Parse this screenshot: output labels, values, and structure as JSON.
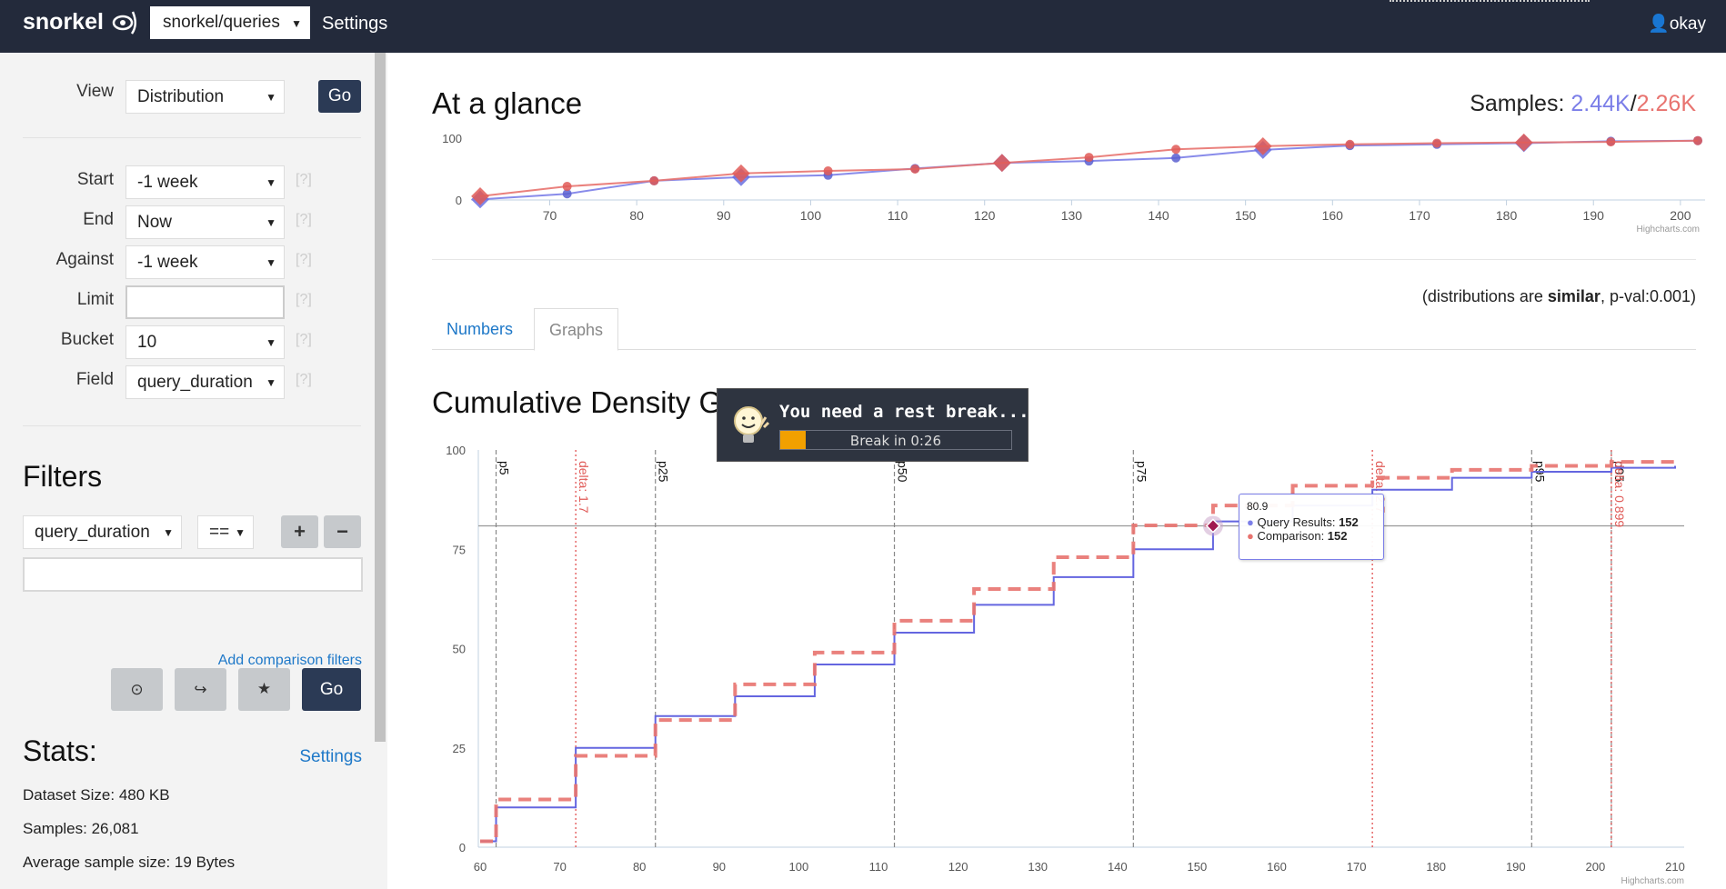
{
  "nav": {
    "logo": "snorkel",
    "dataset": "snorkel/queries",
    "settings": "Settings",
    "user": "okay"
  },
  "controls": {
    "view_label": "View",
    "view_value": "Distribution",
    "go": "Go",
    "start_label": "Start",
    "start_value": "-1 week",
    "end_label": "End",
    "end_value": "Now",
    "against_label": "Against",
    "against_value": "-1 week",
    "limit_label": "Limit",
    "limit_value": "",
    "bucket_label": "Bucket",
    "bucket_value": "10",
    "field_label": "Field",
    "field_value": "query_duration",
    "help": "[?]"
  },
  "filters": {
    "title": "Filters",
    "field": "query_duration",
    "op": "==",
    "plus": "+",
    "minus": "−",
    "value": "",
    "add_comparison": "Add comparison filters",
    "go": "Go"
  },
  "stats": {
    "title": "Stats:",
    "settings": "Settings",
    "dataset_size": "Dataset Size: 480 KB",
    "samples": "Samples: 26,081",
    "avg_size": "Average sample size: 19 Bytes"
  },
  "glance": {
    "title": "At a glance",
    "samples_label": "Samples: ",
    "samples_a": "2.44K",
    "sep": "/",
    "samples_b": "2.26K",
    "color_a": "#7b7ee8",
    "color_b": "#e8736f",
    "credit": "Highcharts.com"
  },
  "similarity": {
    "prefix": "(distributions are ",
    "word": "similar",
    "suffix": ", p-val:0.001)"
  },
  "tabs": [
    {
      "label": "Numbers"
    },
    {
      "label": "Graphs"
    }
  ],
  "cdf": {
    "title": "Cumulative Density G",
    "credit": "Highcharts.com"
  },
  "tooltip": {
    "x": "80.9",
    "s1_label": "Query Results: ",
    "s1_value": "152",
    "s2_label": "Comparison: ",
    "s2_value": "152"
  },
  "popup": {
    "title": "You need a rest break...",
    "progress_label": "Break in 0:26",
    "progress": 0.11
  },
  "chart_data": [
    {
      "type": "line",
      "title": "At a glance",
      "xlim": [
        62,
        202
      ],
      "ylim": [
        0,
        100
      ],
      "x_ticks": [
        70,
        80,
        90,
        100,
        110,
        120,
        130,
        140,
        150,
        160,
        170,
        180,
        190,
        200
      ],
      "y_ticks": [
        0,
        100
      ],
      "series": [
        {
          "name": "Query Results",
          "color": "#7b7ee8",
          "points": [
            [
              62,
              1
            ],
            [
              72,
              10
            ],
            [
              82,
              31
            ],
            [
              92,
              37
            ],
            [
              102,
              40
            ],
            [
              112,
              51
            ],
            [
              122,
              60
            ],
            [
              132,
              63
            ],
            [
              142,
              68
            ],
            [
              152,
              81
            ],
            [
              162,
              88
            ],
            [
              172,
              90
            ],
            [
              182,
              92
            ],
            [
              192,
              95
            ],
            [
              202,
              96
            ]
          ]
        },
        {
          "name": "Comparison",
          "color": "#e8736f",
          "points": [
            [
              62,
              6
            ],
            [
              72,
              22
            ],
            [
              82,
              31
            ],
            [
              92,
              43
            ],
            [
              102,
              47
            ],
            [
              112,
              50
            ],
            [
              122,
              60
            ],
            [
              132,
              69
            ],
            [
              142,
              82
            ],
            [
              152,
              87
            ],
            [
              162,
              90
            ],
            [
              172,
              92
            ],
            [
              182,
              93
            ],
            [
              192,
              94
            ],
            [
              202,
              96
            ]
          ]
        }
      ]
    },
    {
      "type": "line",
      "title": "Cumulative Density G",
      "xlim": [
        60,
        210
      ],
      "ylim": [
        0,
        100
      ],
      "x_ticks": [
        60,
        70,
        80,
        90,
        100,
        110,
        120,
        130,
        140,
        150,
        160,
        170,
        180,
        190,
        200,
        210
      ],
      "y_ticks": [
        0,
        25,
        50,
        75,
        100
      ],
      "series": [
        {
          "name": "Query Results",
          "color": "#6466e0",
          "steps": [
            [
              60,
              1.5
            ],
            [
              62,
              10
            ],
            [
              72,
              25
            ],
            [
              82,
              33
            ],
            [
              92,
              38
            ],
            [
              102,
              46
            ],
            [
              112,
              54
            ],
            [
              122,
              61
            ],
            [
              132,
              68
            ],
            [
              142,
              75
            ],
            [
              152,
              82
            ],
            [
              162,
              86
            ],
            [
              172,
              90
            ],
            [
              182,
              93
            ],
            [
              192,
              94.5
            ],
            [
              202,
              95.5
            ],
            [
              210,
              96
            ]
          ]
        },
        {
          "name": "Comparison",
          "color": "#e8736f",
          "steps": [
            [
              60,
              1.5
            ],
            [
              62,
              12
            ],
            [
              72,
              23
            ],
            [
              82,
              32
            ],
            [
              92,
              41
            ],
            [
              102,
              49
            ],
            [
              112,
              57
            ],
            [
              122,
              65
            ],
            [
              132,
              73
            ],
            [
              142,
              81
            ],
            [
              152,
              86
            ],
            [
              162,
              91
            ],
            [
              172,
              93
            ],
            [
              182,
              95
            ],
            [
              192,
              96
            ],
            [
              202,
              97
            ],
            [
              210,
              97.5
            ]
          ]
        }
      ],
      "percentile_lines": [
        {
          "label": "p5",
          "x": 62,
          "color": "#888"
        },
        {
          "label": "delta: 1.7",
          "x": 72,
          "color": "#e04444"
        },
        {
          "label": "p25",
          "x": 82,
          "color": "#888"
        },
        {
          "label": "p50",
          "x": 112,
          "color": "#888"
        },
        {
          "label": "p75",
          "x": 142,
          "color": "#888"
        },
        {
          "label": "delta: 2.7",
          "x": 172,
          "color": "#e04444"
        },
        {
          "label": "p95",
          "x": 192,
          "color": "#888"
        },
        {
          "label": "p95",
          "x": 202,
          "color": "#888"
        },
        {
          "label": "delta: 0.899",
          "x": 202,
          "color": "#e04444"
        }
      ],
      "crosshair_y": 80.9,
      "marker": [
        152,
        80.9
      ]
    }
  ]
}
